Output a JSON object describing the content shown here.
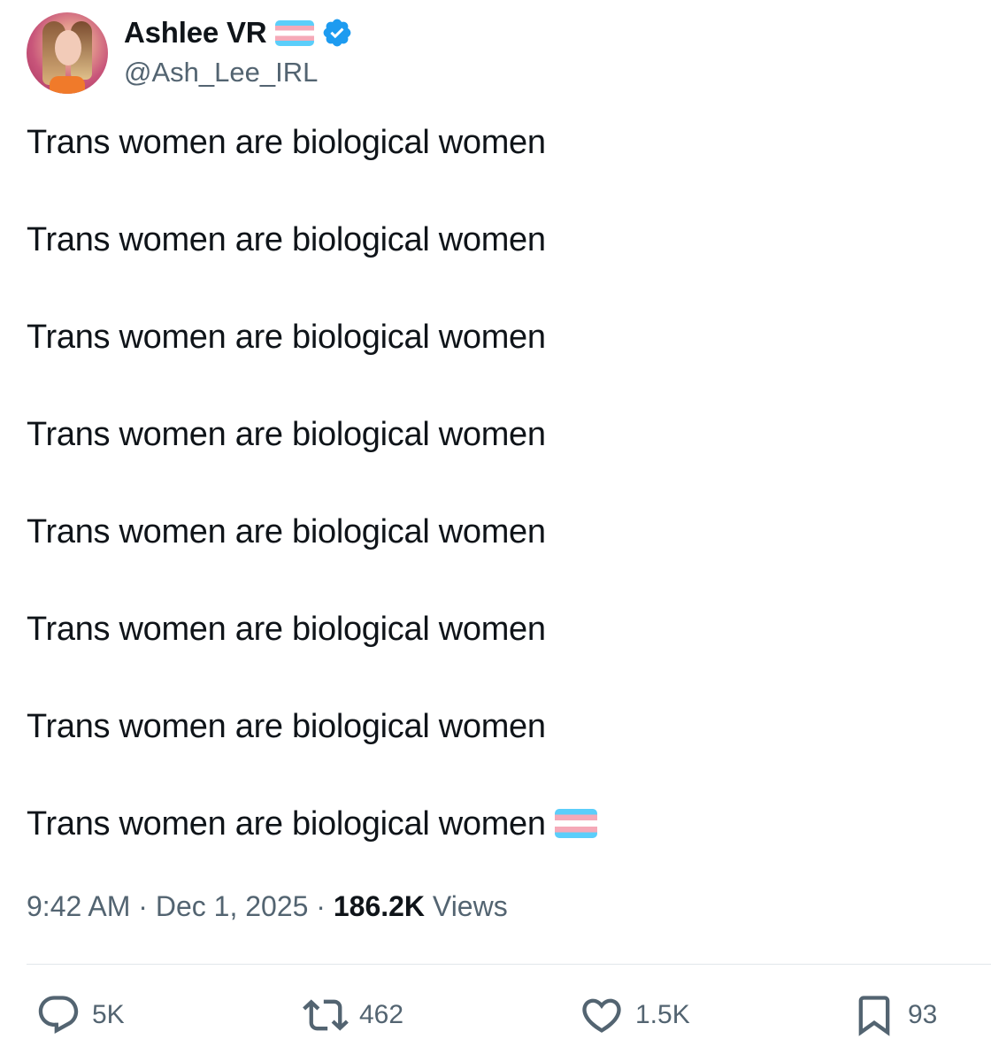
{
  "author": {
    "display_name": "Ashlee VR",
    "handle": "@Ash_Lee_IRL",
    "verified": true,
    "flag_emoji": "transgender-flag"
  },
  "tweet": {
    "lines": [
      "Trans women are biological women",
      "Trans women are biological women",
      "Trans women are biological women",
      "Trans women are biological women",
      "Trans women are biological women",
      "Trans women are biological women",
      "Trans women are biological women",
      "Trans women are biological women"
    ],
    "trailing_emoji": "transgender-flag"
  },
  "meta": {
    "time": "9:42 AM",
    "separator": "·",
    "date": "Dec 1, 2025",
    "views_count": "186.2K",
    "views_label": "Views"
  },
  "actions": {
    "replies": "5K",
    "reposts": "462",
    "likes": "1.5K",
    "bookmarks": "93"
  },
  "colors": {
    "text_primary": "#0f1419",
    "text_secondary": "#536471",
    "verified_blue": "#1d9bf0",
    "flag_blue": "#5bcefa",
    "flag_pink": "#f5a9b8"
  }
}
